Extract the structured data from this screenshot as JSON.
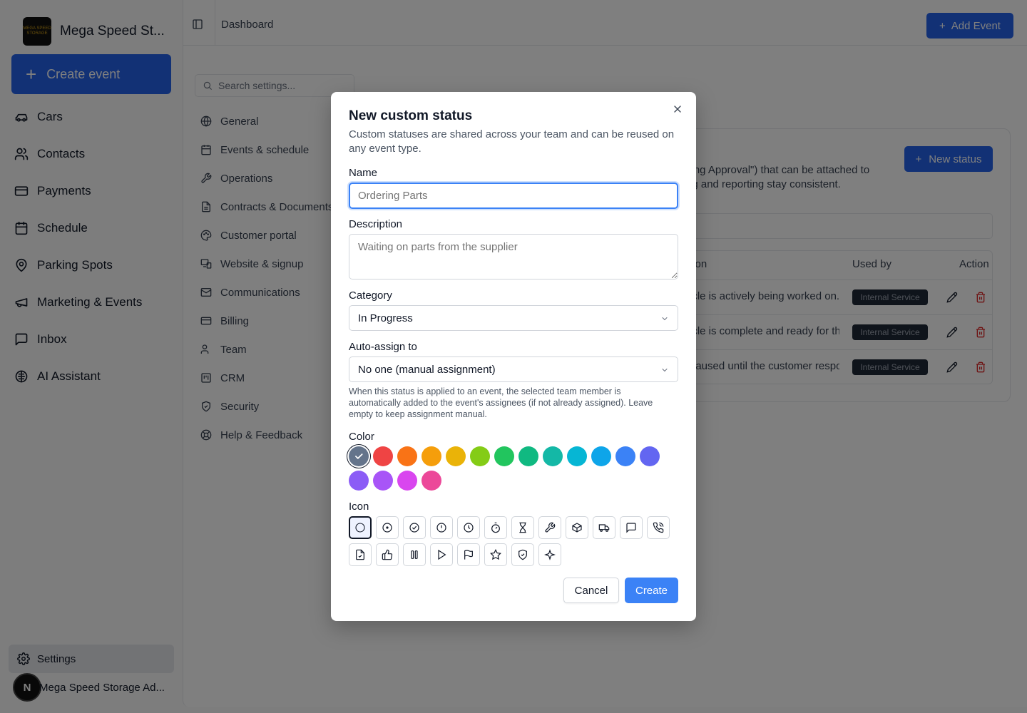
{
  "app": {
    "name": "Mega Speed St...",
    "logo_text": "MEGA SPEED STORAGE"
  },
  "sidebar": {
    "create_event_label": "Create event",
    "items": [
      {
        "label": "Cars",
        "icon": "car-icon"
      },
      {
        "label": "Contacts",
        "icon": "users-icon"
      },
      {
        "label": "Payments",
        "icon": "credit-card-icon"
      },
      {
        "label": "Schedule",
        "icon": "calendar-icon"
      },
      {
        "label": "Parking Spots",
        "icon": "map-pin-icon"
      },
      {
        "label": "Marketing & Events",
        "icon": "megaphone-icon"
      },
      {
        "label": "Inbox",
        "icon": "message-square-icon"
      },
      {
        "label": "AI Assistant",
        "icon": "brain-icon"
      }
    ],
    "settings_label": "Settings",
    "user_initial": "N",
    "user_name": "Mega Speed Storage Ad..."
  },
  "topbar": {
    "breadcrumb": "Dashboard",
    "add_event_label": "Add Event"
  },
  "settings": {
    "search_placeholder": "Search settings...",
    "nav": [
      {
        "label": "General",
        "icon": "globe-icon"
      },
      {
        "label": "Events & schedule",
        "icon": "calendar-icon"
      },
      {
        "label": "Operations",
        "icon": "wrench-icon"
      },
      {
        "label": "Contracts & Documents",
        "icon": "file-text-icon"
      },
      {
        "label": "Customer portal",
        "icon": "palette-icon"
      },
      {
        "label": "Website & signup",
        "icon": "monitor-icon"
      },
      {
        "label": "Communications",
        "icon": "mail-icon"
      },
      {
        "label": "Billing",
        "icon": "credit-card-icon"
      },
      {
        "label": "Team",
        "icon": "users-icon"
      },
      {
        "label": "CRM",
        "icon": "layout-icon"
      },
      {
        "label": "Security",
        "icon": "shield-icon"
      },
      {
        "label": "Help & Feedback",
        "icon": "life-buoy-icon"
      }
    ]
  },
  "status_card": {
    "desc_line1": "iting Approval\") that can be attached to",
    "desc_line2": "ng and reporting stay consistent.",
    "new_status_label": "New status",
    "columns": {
      "description": "tion",
      "used_by": "Used by",
      "actions": "Action"
    },
    "rows": [
      {
        "description": "icle is actively being worked on.",
        "used_by": "Internal Service"
      },
      {
        "description": "icle is complete and ready for the",
        "used_by": "Internal Service"
      },
      {
        "description": "paused until the customer respo",
        "used_by": "Internal Service"
      }
    ]
  },
  "modal": {
    "title": "New custom status",
    "subtitle": "Custom statuses are shared across your team and can be reused on any event type.",
    "name_label": "Name",
    "name_placeholder": "Ordering Parts",
    "description_label": "Description",
    "description_placeholder": "Waiting on parts from the supplier",
    "category_label": "Category",
    "category_value": "In Progress",
    "auto_assign_label": "Auto-assign to",
    "auto_assign_value": "No one (manual assignment)",
    "auto_assign_help": "When this status is applied to an event, the selected team member is automatically added to the event's assignees (if not already assigned). Leave empty to keep assignment manual.",
    "color_label": "Color",
    "colors": [
      "#64748b",
      "#ef4444",
      "#f97316",
      "#f59e0b",
      "#eab308",
      "#84cc16",
      "#22c55e",
      "#10b981",
      "#14b8a6",
      "#06b6d4",
      "#0ea5e9",
      "#3b82f6",
      "#6366f1",
      "#8b5cf6",
      "#a855f7",
      "#d946ef",
      "#ec4899"
    ],
    "selected_color": "#64748b",
    "icon_label": "Icon",
    "icons": [
      "circle-icon",
      "circle-dot-icon",
      "circle-check-icon",
      "circle-alert-icon",
      "clock-icon",
      "timer-icon",
      "hourglass-icon",
      "wrench-icon",
      "package-icon",
      "truck-icon",
      "message-square-icon",
      "phone-call-icon",
      "file-check-icon",
      "thumbs-up-icon",
      "pause-icon",
      "play-icon",
      "flag-icon",
      "star-icon",
      "shield-check-icon",
      "sparkles-icon"
    ],
    "selected_icon": "circle-icon",
    "cancel_label": "Cancel",
    "create_label": "Create"
  }
}
